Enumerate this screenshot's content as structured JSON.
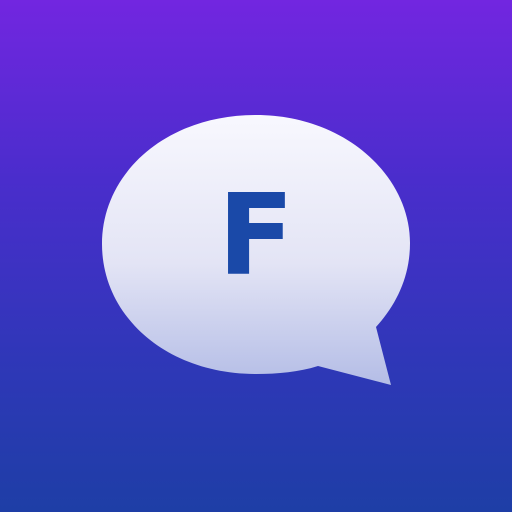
{
  "icon": {
    "letter": "F",
    "letter_color": "#1a49a8",
    "background_top": "#7226e0",
    "background_bottom": "#1e3ea6",
    "bubble_top_color": "#f8f8fe",
    "bubble_bottom_color": "#b4bde6",
    "symbol": "speech-bubble-icon"
  }
}
